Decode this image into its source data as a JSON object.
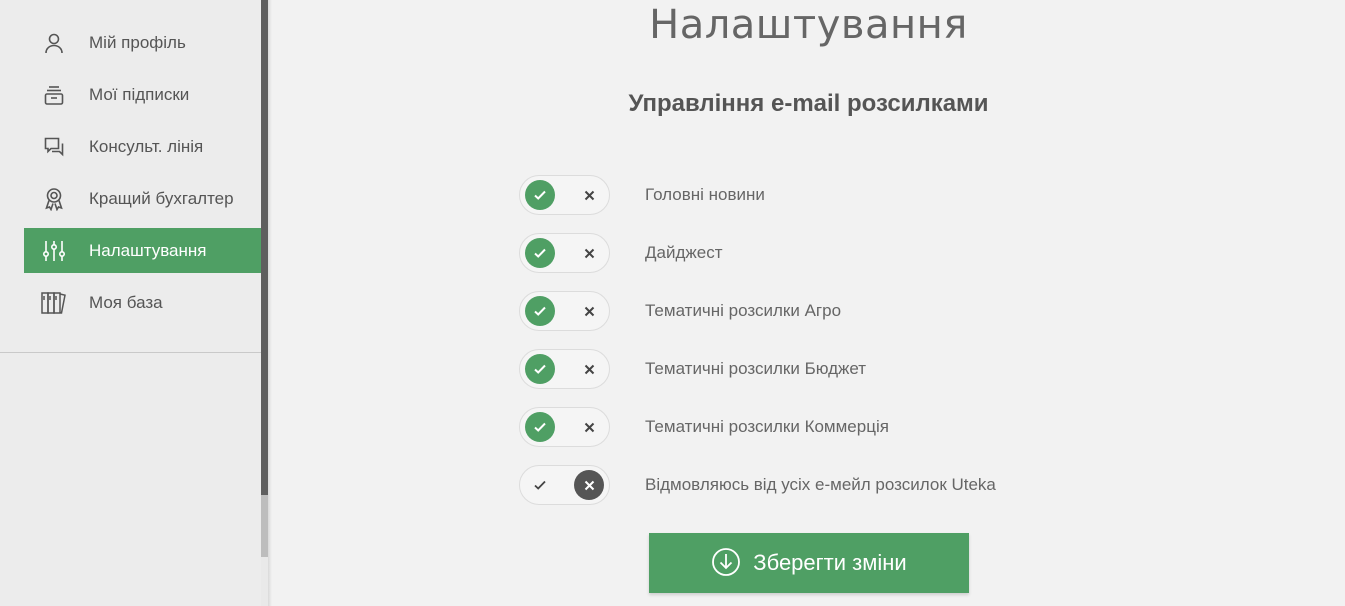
{
  "sidebar": {
    "items": [
      {
        "label": "Мій профіль",
        "icon": "user-icon",
        "active": false
      },
      {
        "label": "Мої підписки",
        "icon": "subscriptions-icon",
        "active": false
      },
      {
        "label": "Консульт. лінія",
        "icon": "chat-icon",
        "active": false
      },
      {
        "label": "Кращий бухгалтер",
        "icon": "award-icon",
        "active": false
      },
      {
        "label": "Налаштування",
        "icon": "sliders-icon",
        "active": true
      },
      {
        "label": "Моя база",
        "icon": "books-icon",
        "active": false
      }
    ]
  },
  "main": {
    "title": "Налаштування",
    "section_title": "Управління e-mail розсилками",
    "options": [
      {
        "label": "Головні новини",
        "enabled": true
      },
      {
        "label": "Дайджест",
        "enabled": true
      },
      {
        "label": "Тематичні розсилки Агро",
        "enabled": true
      },
      {
        "label": "Тематичні розсилки Бюджет",
        "enabled": true
      },
      {
        "label": "Тематичні розсилки Коммерція",
        "enabled": true
      },
      {
        "label": "Відмовляюсь від усіх е-мейл розсилок Uteka",
        "enabled": false
      }
    ],
    "save_label": "Зберегти зміни"
  },
  "colors": {
    "accent": "#4f9f64",
    "dark_knob": "#555555"
  }
}
